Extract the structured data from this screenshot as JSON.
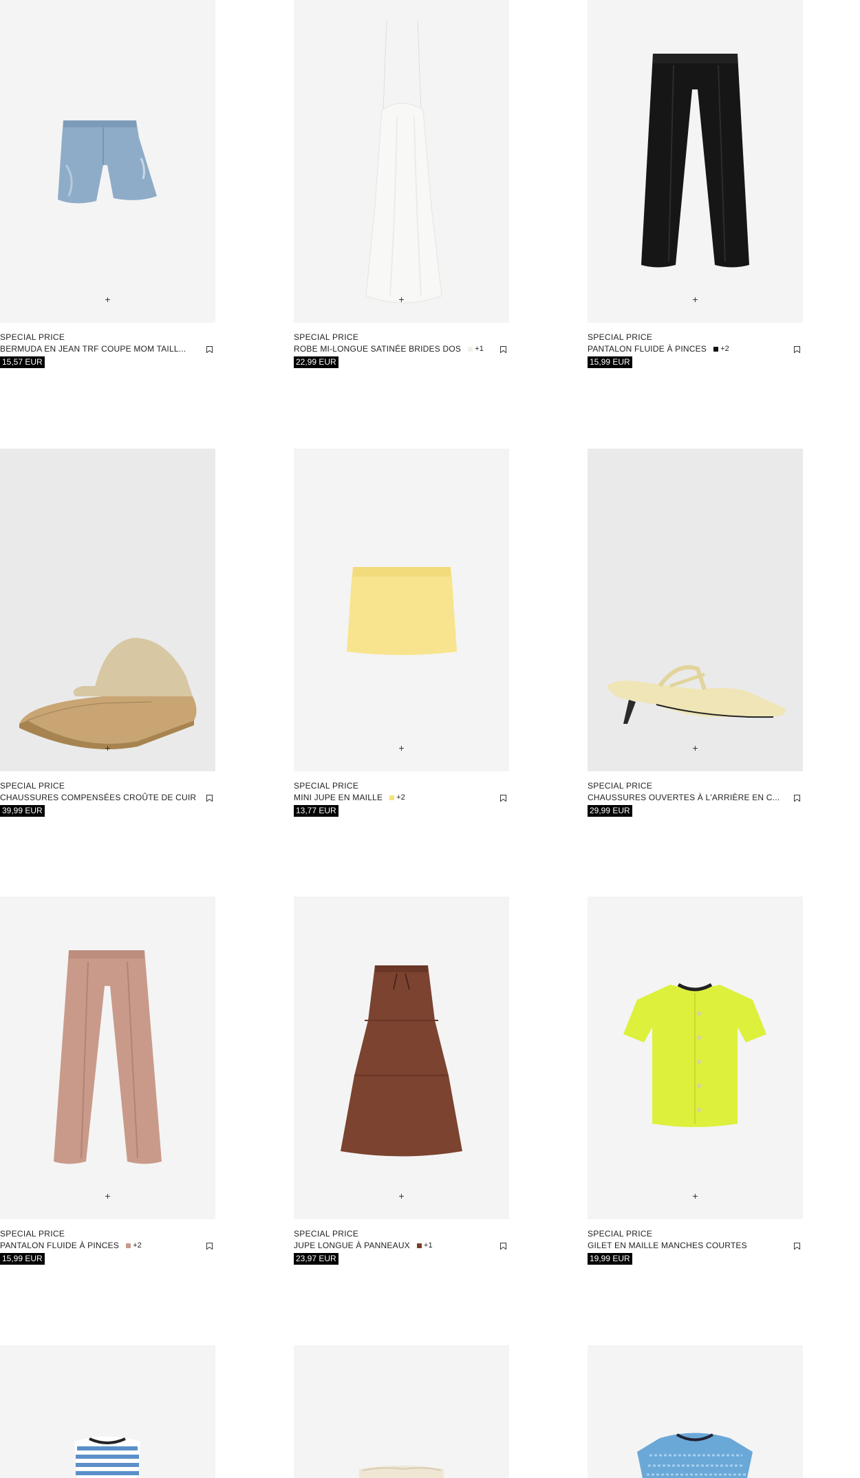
{
  "products": [
    {
      "tag": "SPECIAL PRICE",
      "name": "BERMUDA EN JEAN TRF COUPE MOM TAILL...",
      "price": "15,57 EUR",
      "swatch": "",
      "more": ""
    },
    {
      "tag": "SPECIAL PRICE",
      "name": "ROBE MI-LONGUE SATINÉE BRIDES DOS",
      "price": "22,99 EUR",
      "swatch": "#f1efe8",
      "more": "+1"
    },
    {
      "tag": "SPECIAL PRICE",
      "name": "PANTALON FLUIDE À PINCES",
      "price": "15,99 EUR",
      "swatch": "#111111",
      "more": "+2"
    },
    {
      "tag": "SPECIAL PRICE",
      "name": "CHAUSSURES COMPENSÉES CROÛTE DE CUIR",
      "price": "39,99 EUR",
      "swatch": "",
      "more": ""
    },
    {
      "tag": "SPECIAL PRICE",
      "name": "MINI JUPE EN MAILLE",
      "price": "13,77 EUR",
      "swatch": "#f6e27a",
      "more": "+2"
    },
    {
      "tag": "SPECIAL PRICE",
      "name": "CHAUSSURES OUVERTES À L'ARRIÈRE EN C...",
      "price": "29,99 EUR",
      "swatch": "",
      "more": ""
    },
    {
      "tag": "SPECIAL PRICE",
      "name": "PANTALON FLUIDE À PINCES",
      "price": "15,99 EUR",
      "swatch": "#c89a88",
      "more": "+2"
    },
    {
      "tag": "SPECIAL PRICE",
      "name": "JUPE LONGUE À PANNEAUX",
      "price": "23,97 EUR",
      "swatch": "#7a3e2a",
      "more": "+1"
    },
    {
      "tag": "SPECIAL PRICE",
      "name": "GILET EN MAILLE MANCHES COURTES",
      "price": "19,99 EUR",
      "swatch": "",
      "more": ""
    }
  ],
  "icons": {
    "add": "plus-icon",
    "save": "bookmark-icon"
  },
  "plus_glyph": "+"
}
